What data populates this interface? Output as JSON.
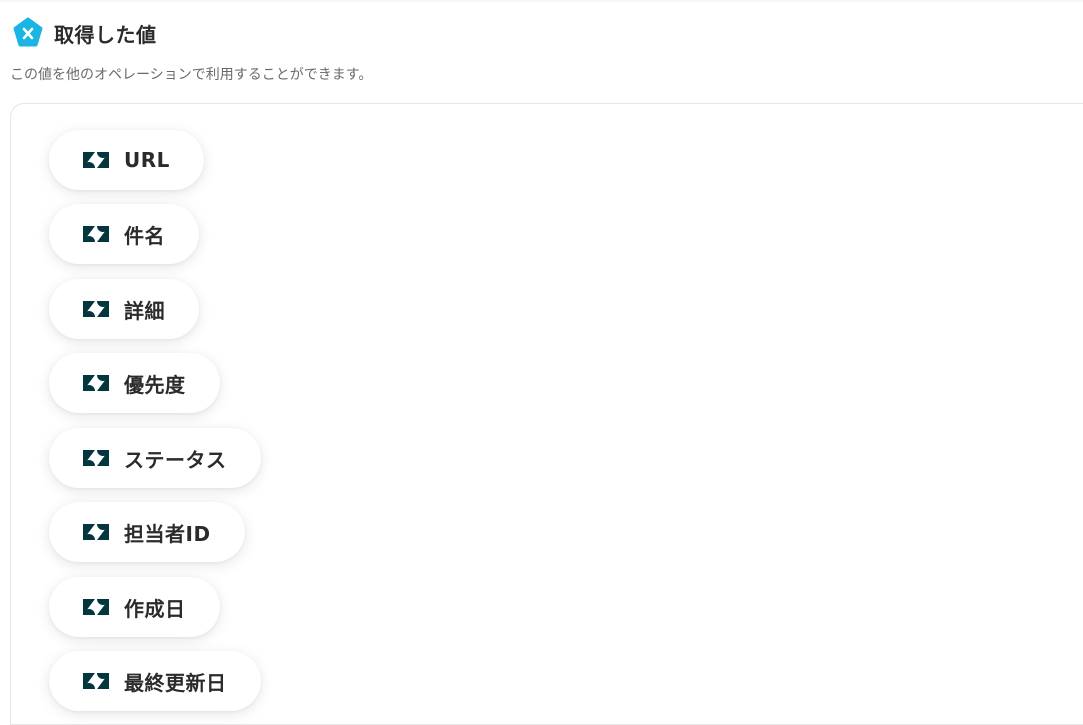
{
  "header": {
    "title": "取得した値",
    "icon": "yoom-x-pentagon-icon",
    "icon_color": "#1ab5e3"
  },
  "description": "この値を他のオペレーションで利用することができます。",
  "values": {
    "icon": "zendesk-logo-icon",
    "icon_color": "#03363d",
    "items": [
      {
        "label": "URL"
      },
      {
        "label": "件名"
      },
      {
        "label": "詳細"
      },
      {
        "label": "優先度"
      },
      {
        "label": "ステータス"
      },
      {
        "label": "担当者ID"
      },
      {
        "label": "作成日"
      },
      {
        "label": "最終更新日"
      }
    ]
  }
}
